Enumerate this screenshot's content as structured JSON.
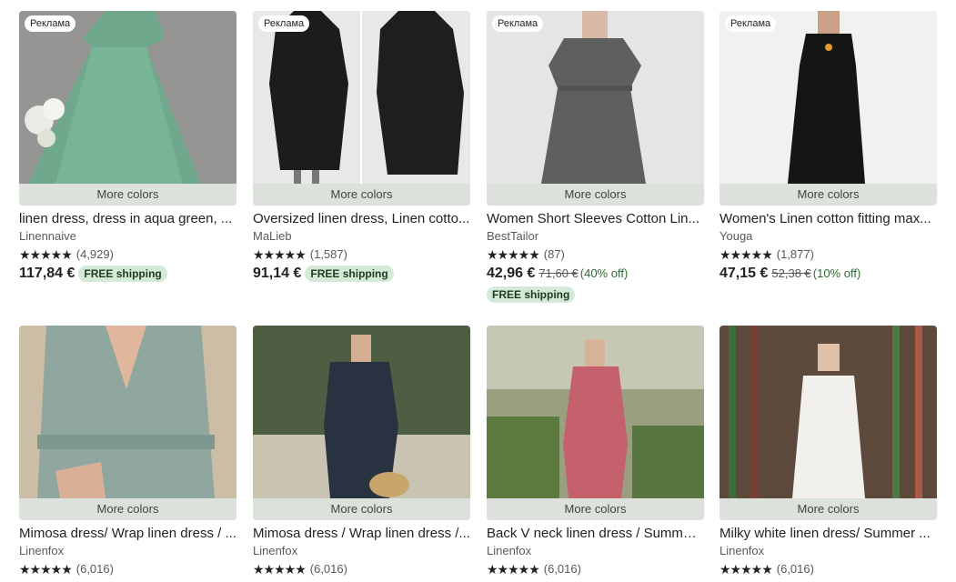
{
  "badge_label": "Реклама",
  "more_colors_label": "More colors",
  "free_shipping_label": "FREE shipping",
  "listings": [
    {
      "title": "linen dress, dress in aqua green, ...",
      "shop": "Linennaive",
      "stars": "★★★★★",
      "reviews": "(4,929)",
      "price": "117,84 €",
      "original_price": "",
      "discount": "",
      "free_shipping": true,
      "free_inline": true,
      "ad": true
    },
    {
      "title": "Oversized linen dress, Linen cotto...",
      "shop": "MaLieb",
      "stars": "★★★★★",
      "reviews": "(1,587)",
      "price": "91,14 €",
      "original_price": "",
      "discount": "",
      "free_shipping": true,
      "free_inline": true,
      "ad": true
    },
    {
      "title": "Women Short Sleeves Cotton Lin...",
      "shop": "BestTailor",
      "stars": "★★★★★",
      "reviews": "(87)",
      "price": "42,96 €",
      "original_price": "71,60 €",
      "discount": "(40% off)",
      "free_shipping": true,
      "free_inline": false,
      "ad": true
    },
    {
      "title": "Women's Linen cotton fitting max...",
      "shop": "Youga",
      "stars": "★★★★★",
      "reviews": "(1,877)",
      "price": "47,15 €",
      "original_price": "52,38 €",
      "discount": "(10% off)",
      "free_shipping": false,
      "free_inline": false,
      "ad": true
    },
    {
      "title": "Mimosa dress/ Wrap linen dress / ...",
      "shop": "Linenfox",
      "stars": "★★★★★",
      "reviews": "(6,016)",
      "price": "",
      "original_price": "",
      "discount": "",
      "free_shipping": false,
      "free_inline": false,
      "ad": false
    },
    {
      "title": "Mimosa dress / Wrap linen dress /...",
      "shop": "Linenfox",
      "stars": "★★★★★",
      "reviews": "(6,016)",
      "price": "",
      "original_price": "",
      "discount": "",
      "free_shipping": false,
      "free_inline": false,
      "ad": false
    },
    {
      "title": "Back V neck linen dress / Summer...",
      "shop": "Linenfox",
      "stars": "★★★★★",
      "reviews": "(6,016)",
      "price": "",
      "original_price": "",
      "discount": "",
      "free_shipping": false,
      "free_inline": false,
      "ad": false
    },
    {
      "title": "Milky white linen dress/ Summer ...",
      "shop": "Linenfox",
      "stars": "★★★★★",
      "reviews": "(6,016)",
      "price": "",
      "original_price": "",
      "discount": "",
      "free_shipping": false,
      "free_inline": false,
      "ad": false
    }
  ]
}
